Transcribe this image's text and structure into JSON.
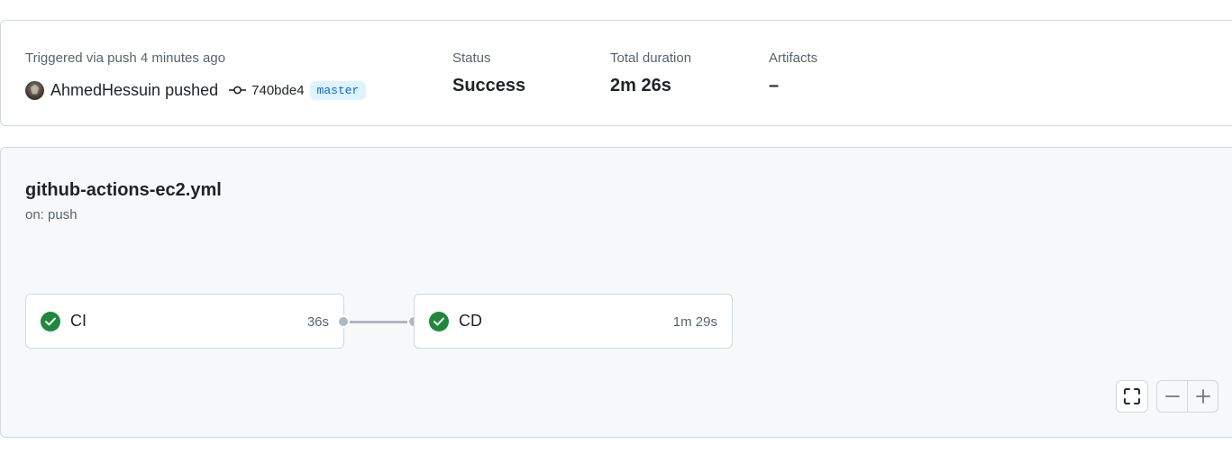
{
  "run": {
    "triggered_text": "Triggered via push 4 minutes ago",
    "actor": "AhmedHessuin",
    "action": "pushed",
    "commit_sha": "740bde4",
    "branch": "master",
    "status_label": "Status",
    "status_value": "Success",
    "duration_label": "Total duration",
    "duration_value": "2m 26s",
    "artifacts_label": "Artifacts",
    "artifacts_value": "–"
  },
  "workflow": {
    "file_name": "github-actions-ec2.yml",
    "trigger": "on: push",
    "jobs": [
      {
        "name": "CI",
        "duration": "36s",
        "status": "success"
      },
      {
        "name": "CD",
        "duration": "1m 29s",
        "status": "success"
      }
    ]
  },
  "controls": {
    "icons": [
      "fullscreen-icon",
      "zoom-out-icon",
      "zoom-in-icon"
    ]
  },
  "colors": {
    "success": "#1f883d",
    "branch_text": "#0969da",
    "branch_bg": "#ddf4ff",
    "panel_bg": "#f6f8fa",
    "border": "#d1d9e0"
  }
}
